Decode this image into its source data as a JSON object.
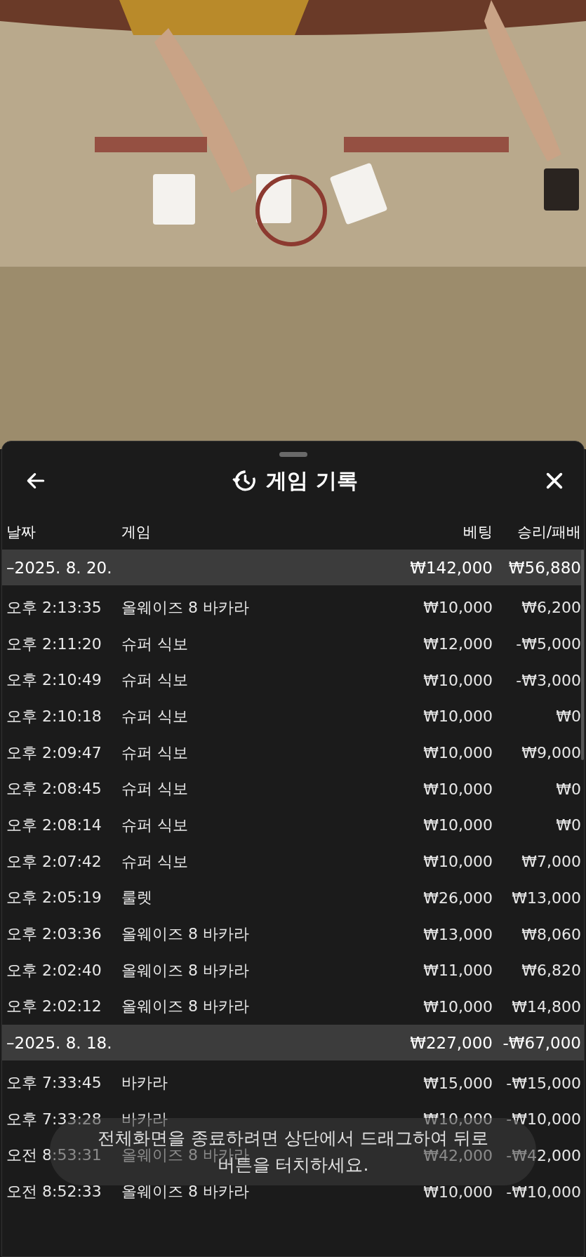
{
  "sheet": {
    "title": "게임 기록"
  },
  "table": {
    "columns": [
      "날짜",
      "게임",
      "베팅",
      "승리/패배"
    ],
    "groups": [
      {
        "date": "–2025. 8. 20.",
        "bet": "₩142,000",
        "result": "₩56,880",
        "rows": [
          {
            "time": "오후 2:13:35",
            "game": "올웨이즈 8 바카라",
            "bet": "₩10,000",
            "result": "₩6,200"
          },
          {
            "time": "오후 2:11:20",
            "game": "슈퍼 식보",
            "bet": "₩12,000",
            "result": "-₩5,000"
          },
          {
            "time": "오후 2:10:49",
            "game": "슈퍼 식보",
            "bet": "₩10,000",
            "result": "-₩3,000"
          },
          {
            "time": "오후 2:10:18",
            "game": "슈퍼 식보",
            "bet": "₩10,000",
            "result": "₩0"
          },
          {
            "time": "오후 2:09:47",
            "game": "슈퍼 식보",
            "bet": "₩10,000",
            "result": "₩9,000"
          },
          {
            "time": "오후 2:08:45",
            "game": "슈퍼 식보",
            "bet": "₩10,000",
            "result": "₩0"
          },
          {
            "time": "오후 2:08:14",
            "game": "슈퍼 식보",
            "bet": "₩10,000",
            "result": "₩0"
          },
          {
            "time": "오후 2:07:42",
            "game": "슈퍼 식보",
            "bet": "₩10,000",
            "result": "₩7,000"
          },
          {
            "time": "오후 2:05:19",
            "game": "룰렛",
            "bet": "₩26,000",
            "result": "₩13,000"
          },
          {
            "time": "오후 2:03:36",
            "game": "올웨이즈 8 바카라",
            "bet": "₩13,000",
            "result": "₩8,060"
          },
          {
            "time": "오후 2:02:40",
            "game": "올웨이즈 8 바카라",
            "bet": "₩11,000",
            "result": "₩6,820"
          },
          {
            "time": "오후 2:02:12",
            "game": "올웨이즈 8 바카라",
            "bet": "₩10,000",
            "result": "₩14,800"
          }
        ]
      },
      {
        "date": "–2025. 8. 18.",
        "bet": "₩227,000",
        "result": "-₩67,000",
        "rows": [
          {
            "time": "오후 7:33:45",
            "game": "바카라",
            "bet": "₩15,000",
            "result": "-₩15,000"
          },
          {
            "time": "오후 7:33:28",
            "game": "바카라",
            "bet": "₩10,000",
            "result": "-₩10,000"
          },
          {
            "time": "오전 8:53:31",
            "game": "올웨이즈 8 바카라",
            "bet": "₩42,000",
            "result": "-₩42,000"
          },
          {
            "time": "오전 8:52:33",
            "game": "올웨이즈 8 바카라",
            "bet": "₩10,000",
            "result": "-₩10,000"
          }
        ]
      }
    ]
  },
  "toast": {
    "text": "전체화면을 종료하려면 상단에서 드래그하여 뒤로 버튼을 터치하세요."
  }
}
